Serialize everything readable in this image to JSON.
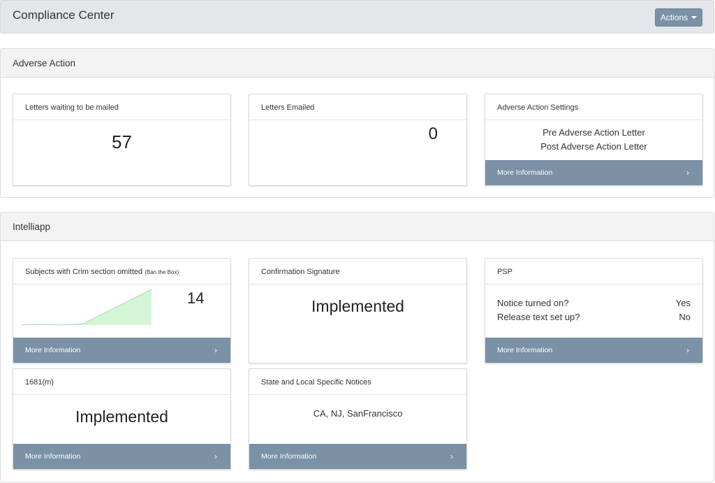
{
  "header": {
    "title": "Compliance Center",
    "actions_label": "Actions"
  },
  "adverse_action": {
    "title": "Adverse Action",
    "letters_waiting": {
      "title": "Letters waiting to be mailed",
      "value": "57"
    },
    "letters_emailed": {
      "title": "Letters Emailed",
      "value": "0"
    },
    "settings": {
      "title": "Adverse Action Settings",
      "lines": [
        "Pre Adverse Action Letter",
        "Post Adverse Action Letter"
      ],
      "more_info": "More Information"
    }
  },
  "intelliapp": {
    "title": "Intelliapp",
    "crim_omitted": {
      "title": "Subjects with Crim section omitted",
      "note": "(Ban the Box)",
      "value": "14",
      "more_info": "More Information",
      "sparkline_color": "#d4f5d6"
    },
    "confirmation_signature": {
      "title": "Confirmation Signature",
      "status": "Implemented"
    },
    "psp": {
      "title": "PSP",
      "rows": [
        {
          "label": "Notice turned on?",
          "value": "Yes"
        },
        {
          "label": "Release text set up?",
          "value": "No"
        }
      ],
      "more_info": "More Information"
    },
    "fcra_1681m": {
      "title": "1681(m)",
      "status": "Implemented",
      "more_info": "More Information"
    },
    "state_local": {
      "title": "State and Local Specific Notices",
      "value": "CA, NJ, SanFrancisco",
      "more_info": "More Information"
    }
  },
  "colors": {
    "accent": "#7a91a6",
    "header_bg": "#e4e6e9",
    "section_bg": "#f3f3f3"
  }
}
